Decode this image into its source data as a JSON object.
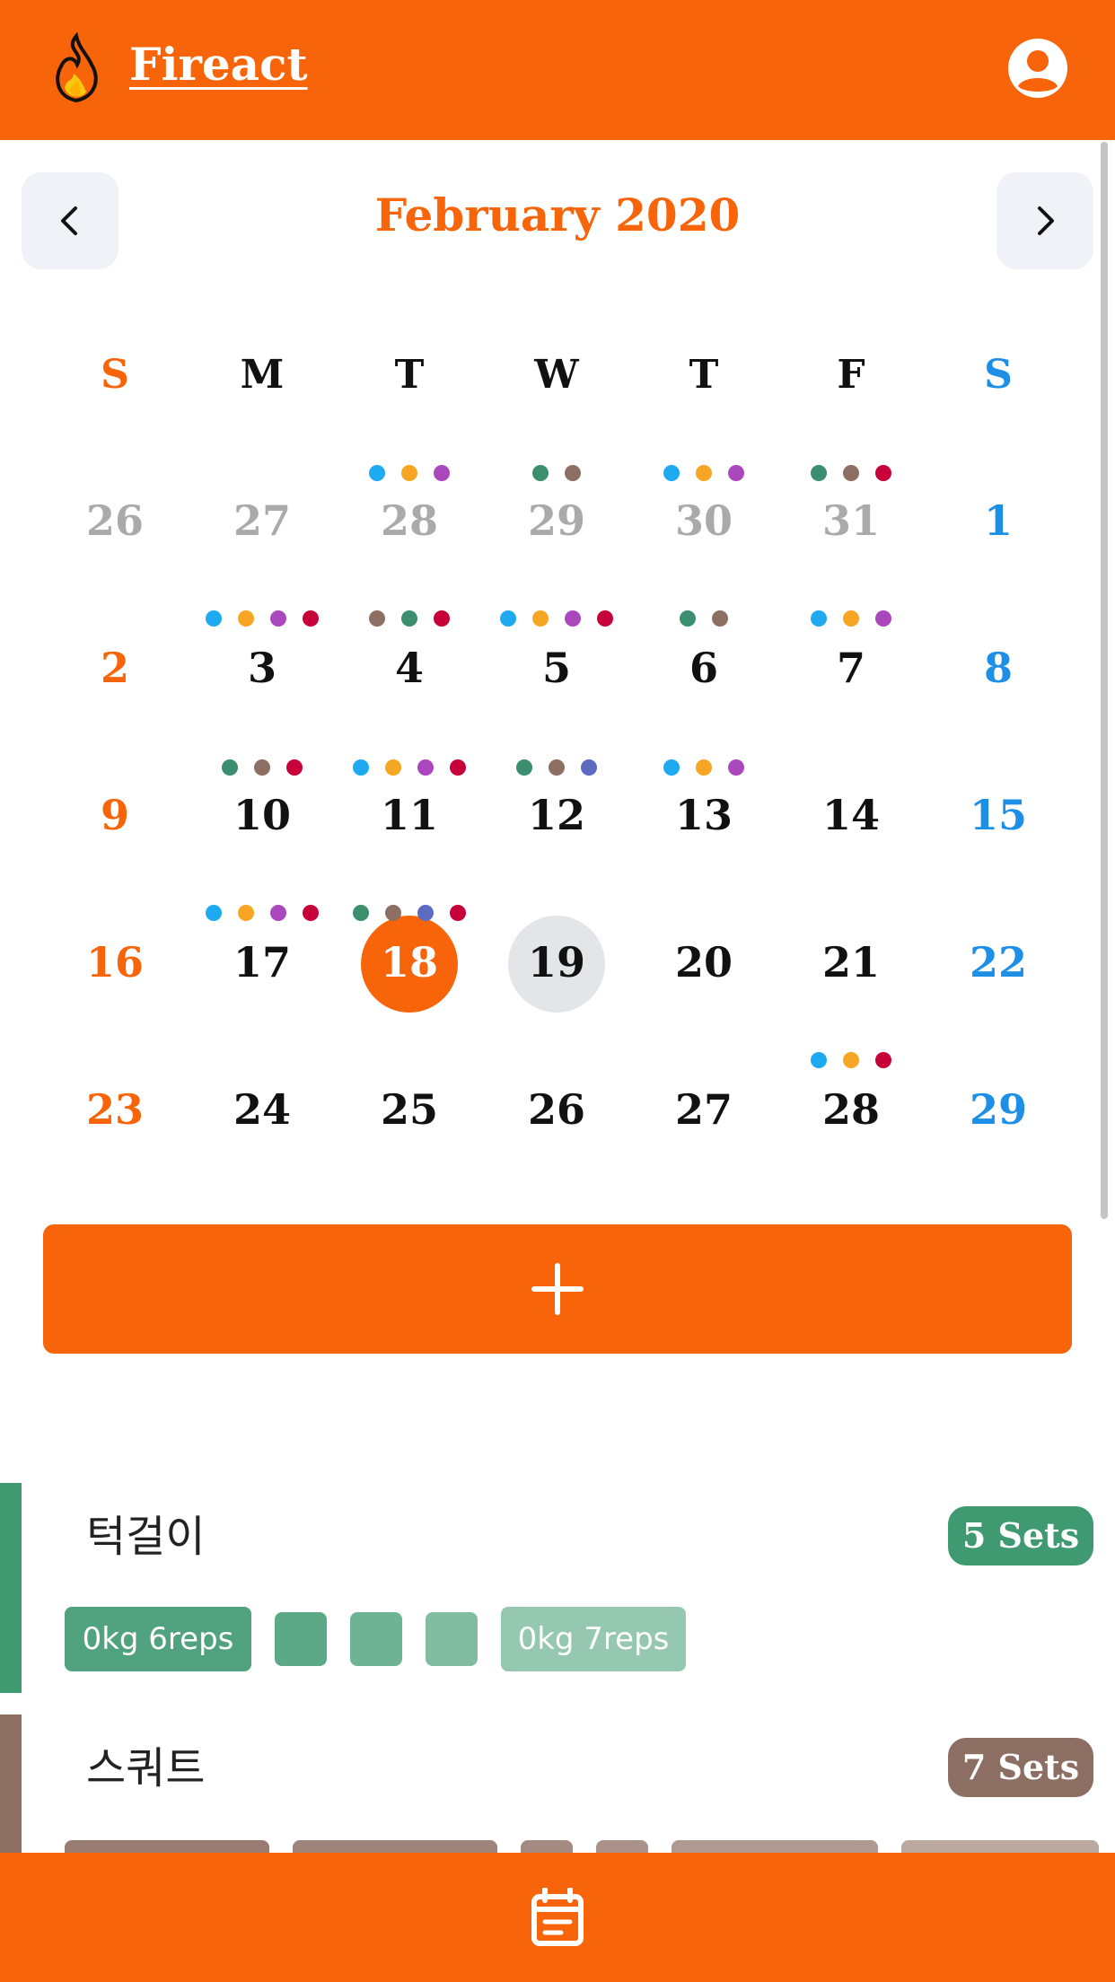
{
  "app": {
    "title": "Fireact",
    "logo_icon": "flame-icon",
    "user_icon": "user-circle-icon"
  },
  "calendar": {
    "month_title": "February 2020",
    "weekdays": [
      "S",
      "M",
      "T",
      "W",
      "T",
      "F",
      "S"
    ],
    "weeks": [
      [
        {
          "day": "26",
          "muted": true,
          "dots": []
        },
        {
          "day": "27",
          "muted": true,
          "dots": []
        },
        {
          "day": "28",
          "muted": true,
          "dots": [
            "#1eaaf1",
            "#f6a623",
            "#ab47bc"
          ]
        },
        {
          "day": "29",
          "muted": true,
          "dots": [
            "#3b8f6e",
            "#8d6e63"
          ]
        },
        {
          "day": "30",
          "muted": true,
          "dots": [
            "#1eaaf1",
            "#f6a623",
            "#ab47bc"
          ]
        },
        {
          "day": "31",
          "muted": true,
          "dots": [
            "#3b8f6e",
            "#8d6e63",
            "#c8003a"
          ]
        },
        {
          "day": "1",
          "muted": false,
          "dots": []
        }
      ],
      [
        {
          "day": "2",
          "dots": []
        },
        {
          "day": "3",
          "dots": [
            "#1eaaf1",
            "#f6a623",
            "#ab47bc",
            "#c8003a"
          ]
        },
        {
          "day": "4",
          "dots": [
            "#8d6e63",
            "#3b8f6e",
            "#c8003a"
          ]
        },
        {
          "day": "5",
          "dots": [
            "#1eaaf1",
            "#f6a623",
            "#ab47bc",
            "#c8003a"
          ]
        },
        {
          "day": "6",
          "dots": [
            "#3b8f6e",
            "#8d6e63"
          ]
        },
        {
          "day": "7",
          "dots": [
            "#1eaaf1",
            "#f6a623",
            "#ab47bc"
          ]
        },
        {
          "day": "8",
          "dots": []
        }
      ],
      [
        {
          "day": "9",
          "dots": []
        },
        {
          "day": "10",
          "dots": [
            "#3b8f6e",
            "#8d6e63",
            "#c8003a"
          ]
        },
        {
          "day": "11",
          "dots": [
            "#1eaaf1",
            "#f6a623",
            "#ab47bc",
            "#c8003a"
          ]
        },
        {
          "day": "12",
          "dots": [
            "#3b8f6e",
            "#8d6e63",
            "#5c6bc0"
          ]
        },
        {
          "day": "13",
          "dots": [
            "#1eaaf1",
            "#f6a623",
            "#ab47bc"
          ]
        },
        {
          "day": "14",
          "dots": []
        },
        {
          "day": "15",
          "dots": []
        }
      ],
      [
        {
          "day": "16",
          "dots": []
        },
        {
          "day": "17",
          "dots": [
            "#1eaaf1",
            "#f6a623",
            "#ab47bc",
            "#c8003a"
          ]
        },
        {
          "day": "18",
          "selected": true,
          "dots": [
            "#3b8f6e",
            "#8d6e63",
            "#5c6bc0",
            "#c8003a"
          ]
        },
        {
          "day": "19",
          "hover": true,
          "dots": []
        },
        {
          "day": "20",
          "dots": []
        },
        {
          "day": "21",
          "dots": []
        },
        {
          "day": "22",
          "dots": []
        }
      ],
      [
        {
          "day": "23",
          "dots": []
        },
        {
          "day": "24",
          "dots": []
        },
        {
          "day": "25",
          "dots": []
        },
        {
          "day": "26",
          "dots": []
        },
        {
          "day": "27",
          "dots": []
        },
        {
          "day": "28",
          "dots": [
            "#1eaaf1",
            "#f6a623",
            "#c8003a"
          ]
        },
        {
          "day": "29",
          "dots": []
        }
      ]
    ],
    "colors": {
      "sunday": "#f76409",
      "saturday": "#1e8fe6",
      "muted": "#aaaaaa",
      "accent": "#f76409"
    }
  },
  "add_button": {
    "icon": "plus-icon"
  },
  "exercises": [
    {
      "name": "턱걸이",
      "sets_label": "5 Sets",
      "color": "#3f9a72",
      "sets": [
        {
          "label": "0kg 6reps",
          "opacity": 0.9
        },
        {
          "label": "",
          "opacity": 0.85
        },
        {
          "label": "",
          "opacity": 0.75
        },
        {
          "label": "",
          "opacity": 0.65
        },
        {
          "label": "0kg 7reps",
          "opacity": 0.55
        }
      ]
    },
    {
      "name": "스쿼트",
      "sets_label": "7 Sets",
      "color": "#8d6e63",
      "sets": [
        {
          "label": "",
          "opacity": 0.9
        },
        {
          "label": "",
          "opacity": 0.85
        },
        {
          "label": "",
          "opacity": 0.8
        },
        {
          "label": "",
          "opacity": 0.75
        },
        {
          "label": "",
          "opacity": 0.7
        },
        {
          "label": "",
          "opacity": 0.6
        }
      ]
    }
  ],
  "footer": {
    "icon": "calendar-note-icon"
  }
}
